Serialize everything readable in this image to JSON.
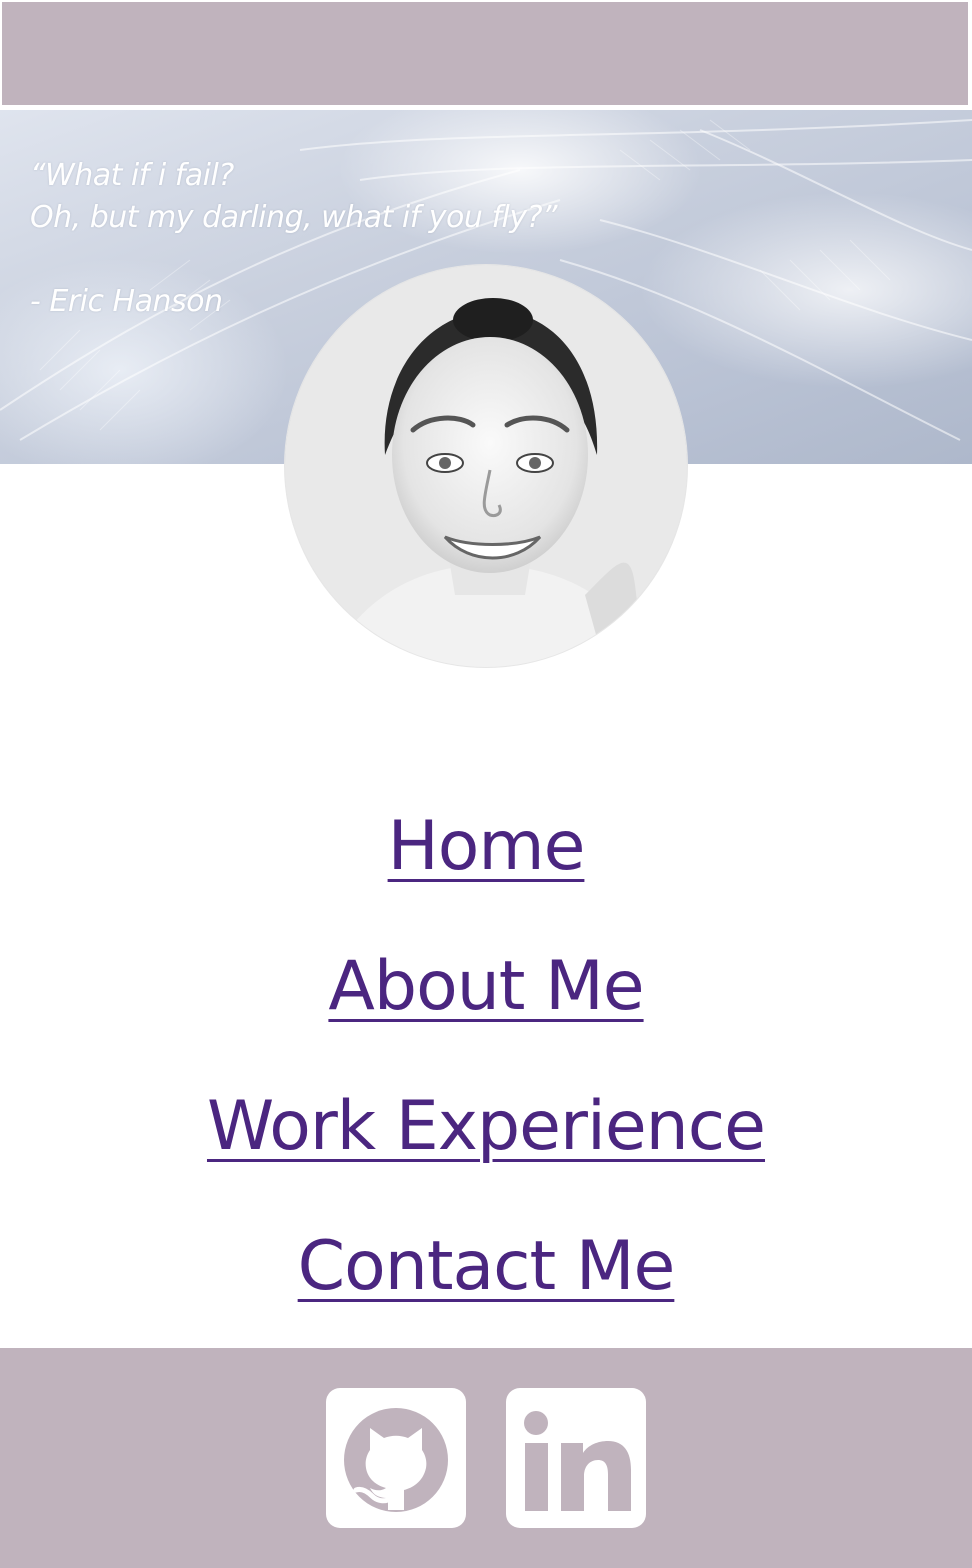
{
  "quote": {
    "line1": "“What if i fail?",
    "line2": "Oh, but my darling, what if you fly?”",
    "author": "- Eric Hanson"
  },
  "nav": {
    "items": [
      {
        "label": "Home"
      },
      {
        "label": "About Me"
      },
      {
        "label": "Work Experience"
      },
      {
        "label": "Contact Me"
      }
    ]
  },
  "colors": {
    "header_bg": "#c0b3bd",
    "footer_bg": "#c0b3bd",
    "link": "#4b2680",
    "quote_text": "#ffffff"
  },
  "social": {
    "icons": [
      "github-icon",
      "linkedin-icon"
    ]
  }
}
